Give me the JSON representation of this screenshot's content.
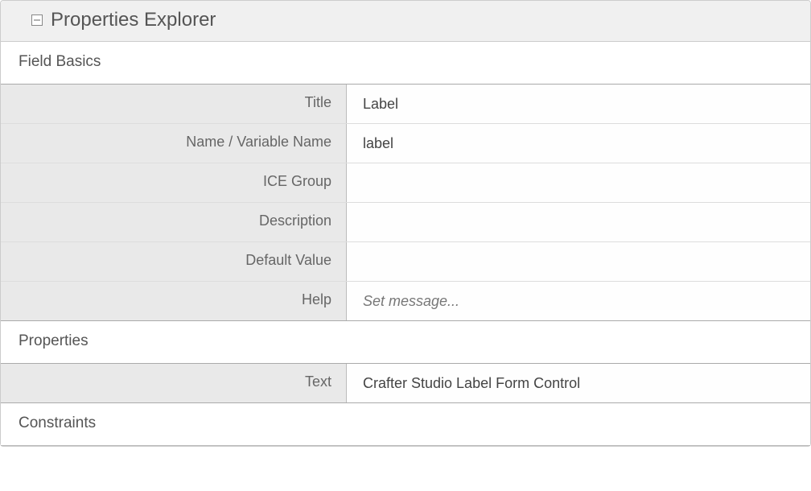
{
  "panel": {
    "title": "Properties Explorer"
  },
  "sections": {
    "fieldBasics": {
      "heading": "Field Basics",
      "rows": [
        {
          "label": "Title",
          "value": "Label",
          "placeholder": ""
        },
        {
          "label": "Name / Variable Name",
          "value": "label",
          "placeholder": ""
        },
        {
          "label": "ICE Group",
          "value": "",
          "placeholder": ""
        },
        {
          "label": "Description",
          "value": "",
          "placeholder": ""
        },
        {
          "label": "Default Value",
          "value": "",
          "placeholder": ""
        },
        {
          "label": "Help",
          "value": "",
          "placeholder": "Set message..."
        }
      ]
    },
    "properties": {
      "heading": "Properties",
      "rows": [
        {
          "label": "Text",
          "value": "Crafter Studio Label Form Control",
          "placeholder": ""
        }
      ]
    },
    "constraints": {
      "heading": "Constraints",
      "rows": []
    }
  }
}
